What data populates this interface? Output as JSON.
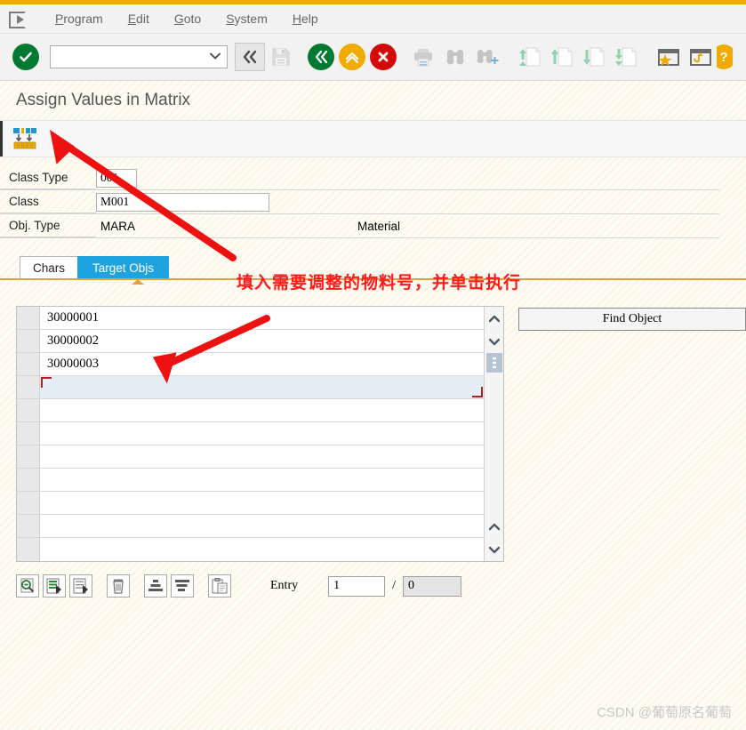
{
  "window": {
    "accent_color": "#f0ab00"
  },
  "menubar": {
    "exit_icon": "exit-icon",
    "items": [
      {
        "label": "Program",
        "accel": "P"
      },
      {
        "label": "Edit",
        "accel": "E"
      },
      {
        "label": "Goto",
        "accel": "G"
      },
      {
        "label": "System",
        "accel": "S"
      },
      {
        "label": "Help",
        "accel": "H"
      }
    ]
  },
  "toolbar": {
    "enter_label": "✓",
    "command_field": {
      "value": "",
      "placeholder": ""
    },
    "enter_button_label": "«",
    "icons": [
      {
        "name": "save-icon",
        "enabled": false
      },
      {
        "name": "back-icon",
        "enabled": true,
        "color": "#007a33"
      },
      {
        "name": "exit-up-icon",
        "enabled": true,
        "color": "#f0ab00"
      },
      {
        "name": "cancel-icon",
        "enabled": true,
        "color": "#d20a0a"
      },
      {
        "name": "print-icon",
        "enabled": false
      },
      {
        "name": "find-icon",
        "enabled": true
      },
      {
        "name": "find-next-icon",
        "enabled": true
      },
      {
        "name": "first-page-icon",
        "enabled": true
      },
      {
        "name": "previous-page-icon",
        "enabled": true
      },
      {
        "name": "next-page-icon",
        "enabled": true
      },
      {
        "name": "last-page-icon",
        "enabled": true
      },
      {
        "name": "favorites-icon",
        "enabled": true
      },
      {
        "name": "customize-layout-icon",
        "enabled": true
      },
      {
        "name": "help-icon",
        "enabled": true
      }
    ]
  },
  "page": {
    "title": "Assign Values in Matrix"
  },
  "app_toolbar": {
    "execute_icon": "execute-matrix-icon"
  },
  "form": {
    "rows": [
      {
        "label": "Class Type",
        "value": "001",
        "kind": "input",
        "width": 46,
        "right_label": ""
      },
      {
        "label": "Class",
        "value": "M001",
        "kind": "input",
        "width": 195,
        "right_label": ""
      },
      {
        "label": "Obj. Type",
        "value": "MARA",
        "kind": "text",
        "right_label": "Material"
      }
    ]
  },
  "tabs": [
    {
      "label": "Chars",
      "active": false
    },
    {
      "label": "Target Objs",
      "active": true
    }
  ],
  "annotation": {
    "text": "填入需要调整的物料号，并单击执行",
    "color": "#ff1a1a"
  },
  "table": {
    "rows": [
      {
        "value": "30000001",
        "selected": false
      },
      {
        "value": "30000002",
        "selected": false
      },
      {
        "value": "30000003",
        "selected": false
      },
      {
        "value": "",
        "selected": true
      },
      {
        "value": "",
        "selected": false
      },
      {
        "value": "",
        "selected": false
      },
      {
        "value": "",
        "selected": false
      },
      {
        "value": "",
        "selected": false
      },
      {
        "value": "",
        "selected": false
      },
      {
        "value": "",
        "selected": false
      },
      {
        "value": "",
        "selected": false
      }
    ],
    "scrollbar": {
      "up_glyph": "▲",
      "down_glyph": "▼",
      "thumb_glyph": "⋮"
    }
  },
  "side_panel": {
    "find_object_label": "Find Object"
  },
  "bottom_toolbar": {
    "icons": [
      {
        "name": "search-entry-icon"
      },
      {
        "name": "insert-row-icon"
      },
      {
        "name": "delete-row-icon"
      },
      {
        "name": "trash-icon"
      },
      {
        "name": "sort-ascending-icon"
      },
      {
        "name": "sort-descending-icon"
      },
      {
        "name": "paste-clipboard-icon"
      }
    ],
    "entry_label": "Entry",
    "entry_current": "1",
    "entry_separator": "/",
    "entry_total": "0"
  },
  "watermark": {
    "text": "CSDN @葡萄原名葡萄"
  }
}
